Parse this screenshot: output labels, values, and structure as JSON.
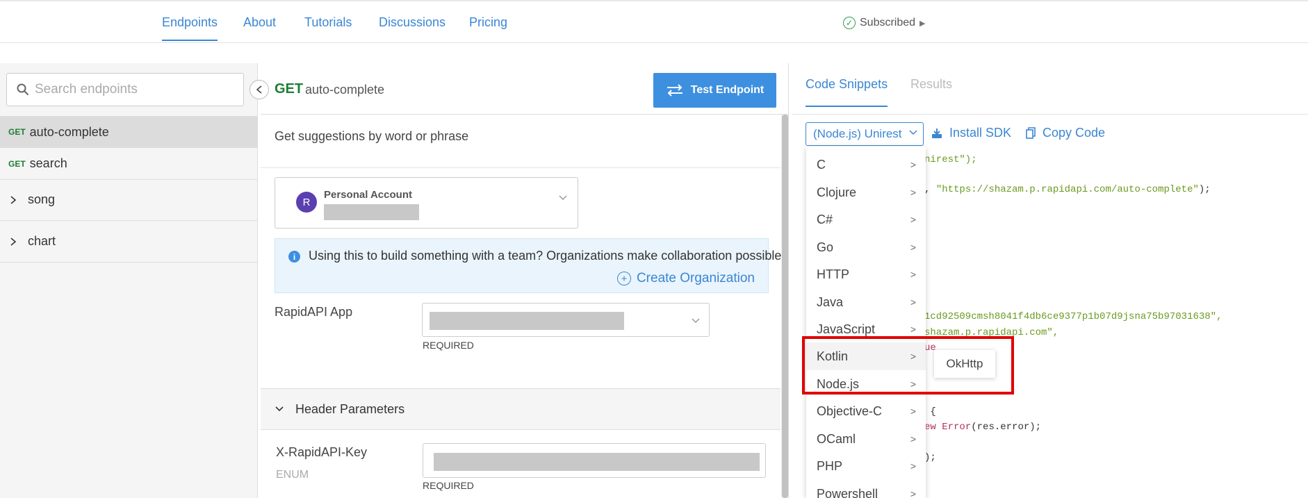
{
  "topnav": {
    "tabs": [
      {
        "label": "Endpoints"
      },
      {
        "label": "About"
      },
      {
        "label": "Tutorials"
      },
      {
        "label": "Discussions"
      },
      {
        "label": "Pricing"
      }
    ],
    "subscribed": "Subscribed"
  },
  "sidebar": {
    "search_placeholder": "Search endpoints",
    "endpoints": [
      {
        "method": "GET",
        "name": "auto-complete"
      },
      {
        "method": "GET",
        "name": "search"
      }
    ],
    "groups": [
      {
        "name": "song"
      },
      {
        "name": "chart"
      }
    ]
  },
  "endpoint": {
    "method": "GET",
    "name": "auto-complete",
    "test_button": "Test Endpoint",
    "description": "Get suggestions by word or phrase",
    "account": {
      "initial": "R",
      "name": "Personal Account"
    },
    "banner": {
      "text": "Using this to build something with a team? Organizations make collaboration possible.",
      "link": "Create Organization"
    },
    "app_field": {
      "label": "RapidAPI App",
      "required": "REQUIRED"
    },
    "header_section": "Header Parameters",
    "key_field": {
      "label": "X-RapidAPI-Key",
      "sub": "ENUM",
      "required": "REQUIRED"
    }
  },
  "right": {
    "tabs": [
      {
        "label": "Code Snippets"
      },
      {
        "label": "Results"
      }
    ],
    "language_select": "(Node.js) Unirest",
    "install_sdk": "Install SDK",
    "copy_code": "Copy Code",
    "code": {
      "l1": "nirest\");",
      "l2a": ", ",
      "l2b": "\"https://shazam.p.rapidapi.com/auto-complete\"",
      "l2c": ");",
      "l3": "1cd92509cmsh8041f4db6ce9377p1b07d9jsna75b97031638\",",
      "l4": "shazam.p.rapidapi.com\",",
      "l5": "ue",
      "l6": " {",
      "l7a": "ew ",
      "l7b": "Error",
      "l7c": "(res.error);",
      "l8": ");"
    }
  },
  "dropdown": {
    "items": [
      {
        "label": "C"
      },
      {
        "label": "Clojure"
      },
      {
        "label": "C#"
      },
      {
        "label": "Go"
      },
      {
        "label": "HTTP"
      },
      {
        "label": "Java"
      },
      {
        "label": "JavaScript"
      },
      {
        "label": "Kotlin"
      },
      {
        "label": "Node.js"
      },
      {
        "label": "Objective-C"
      },
      {
        "label": "OCaml"
      },
      {
        "label": "PHP"
      },
      {
        "label": "Powershell"
      }
    ],
    "submenu": "OkHttp"
  },
  "colors": {
    "accent": "#3a86d4",
    "button": "#3d8fe0",
    "get": "#1e7e34",
    "highlight_box": "#e00000"
  }
}
